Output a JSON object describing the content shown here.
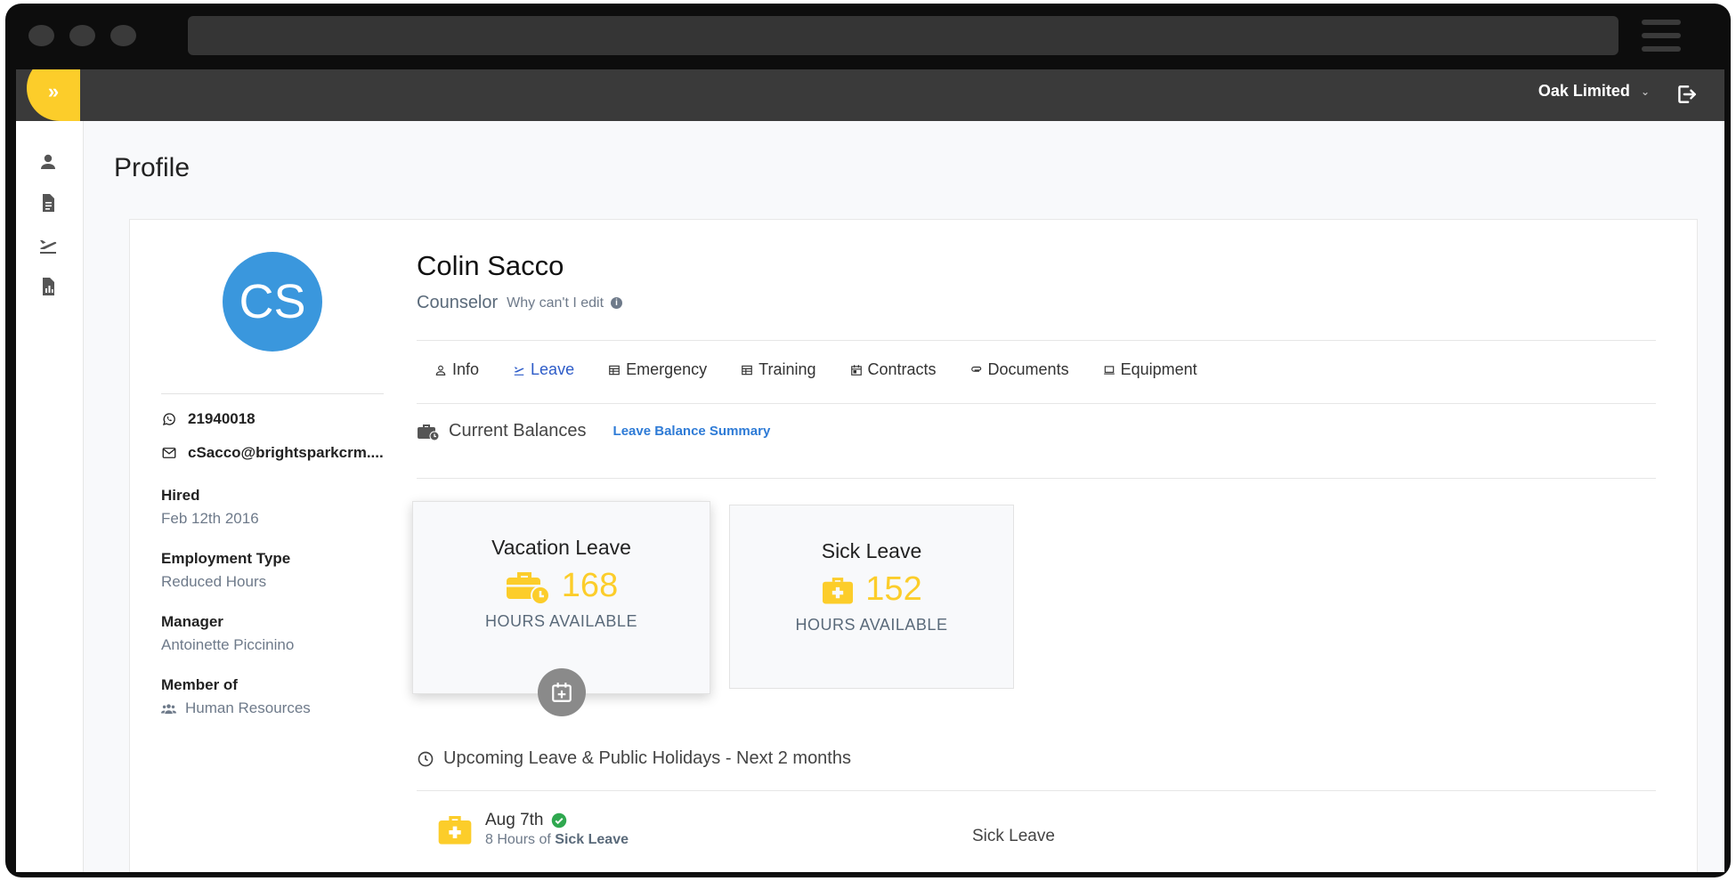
{
  "topbar": {
    "company": "Oak Limited"
  },
  "page": {
    "title": "Profile"
  },
  "profile": {
    "initials": "CS",
    "name": "Colin Sacco",
    "role": "Counselor",
    "why_cant_edit": "Why can't I edit",
    "phone": "21940018",
    "email": "cSacco@brightsparkcrm....",
    "hired_label": "Hired",
    "hired_value": "Feb 12th 2016",
    "employment_type_label": "Employment Type",
    "employment_type_value": "Reduced Hours",
    "manager_label": "Manager",
    "manager_value": "Antoinette Piccinino",
    "member_of_label": "Member of",
    "member_of_value": "Human Resources",
    "colors": {
      "avatar": "#3a97dd",
      "accent": "#fccd2a",
      "active_tab": "#2e5cc8"
    }
  },
  "tabs": [
    {
      "label": "Info",
      "icon": "user-icon"
    },
    {
      "label": "Leave",
      "icon": "plane-departure-icon",
      "active": true
    },
    {
      "label": "Emergency",
      "icon": "table-icon"
    },
    {
      "label": "Training",
      "icon": "table-icon"
    },
    {
      "label": "Contracts",
      "icon": "calendar-icon"
    },
    {
      "label": "Documents",
      "icon": "paperclip-icon"
    },
    {
      "label": "Equipment",
      "icon": "laptop-icon"
    }
  ],
  "balances": {
    "title": "Current Balances",
    "summary_link": "Leave Balance Summary",
    "vacation": {
      "title": "Vacation Leave",
      "value": "168",
      "unit": "HOURS AVAILABLE"
    },
    "sick": {
      "title": "Sick Leave",
      "value": "152",
      "unit": "HOURS AVAILABLE"
    }
  },
  "upcoming": {
    "title": "Upcoming Leave & Public Holidays - Next 2 months",
    "items": [
      {
        "date": "Aug 7th",
        "hours_prefix": "8 Hours of",
        "leave_type_bold": "Sick Leave",
        "type": "Sick Leave"
      }
    ]
  }
}
